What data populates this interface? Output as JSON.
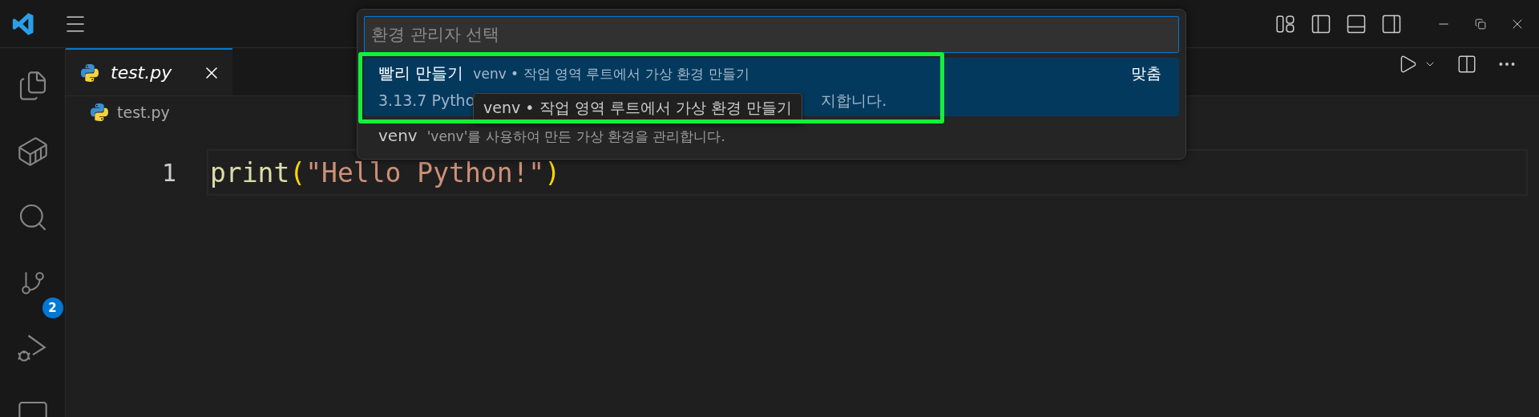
{
  "activity_bar": {
    "scm_badge": "2"
  },
  "tabs": [
    {
      "label": "test.py",
      "selected": true,
      "preview": true
    }
  ],
  "breadcrumb": [
    "test.py"
  ],
  "editor": {
    "lines": [
      {
        "number": "1",
        "tokens": [
          {
            "kind": "function",
            "text": "print"
          },
          {
            "kind": "bracket",
            "text": "("
          },
          {
            "kind": "string",
            "text": "\"Hello Python!\""
          },
          {
            "kind": "bracket",
            "text": ")"
          }
        ]
      }
    ]
  },
  "quick_pick": {
    "placeholder": "환경 관리자 선택",
    "items": [
      {
        "label": "빨리 만들기",
        "description": "venv • 작업 영역 루트에서 가상 환경 만들기",
        "badge": "맞춤",
        "detail_start": "3.13.7 Pytho",
        "detail_end": "지합니다.",
        "selected": true
      },
      {
        "label": "venv",
        "description": "'venv'를 사용하여 만든 가상 환경을 관리합니다.",
        "selected": false
      }
    ],
    "tooltip": "venv • 작업 영역 루트에서 가상 환경 만들기"
  }
}
